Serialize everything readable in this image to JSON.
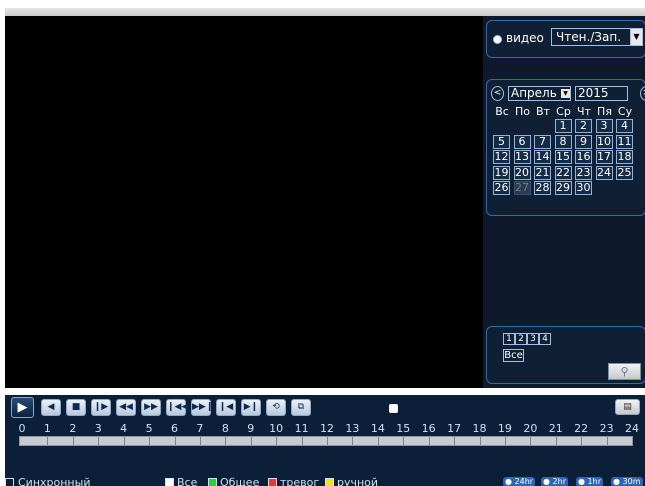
{
  "right_panel": {
    "mode": {
      "label": "видео",
      "selected": "Чтен./Зап."
    },
    "calendar": {
      "month": "Апрель",
      "year": "2015",
      "prev": "<",
      "next": ">",
      "weekdays": [
        "Вс",
        "По",
        "Вт",
        "Ср",
        "Чт",
        "Пя",
        "Су"
      ],
      "days": [
        "1",
        "2",
        "3",
        "4",
        "5",
        "6",
        "7",
        "8",
        "9",
        "10",
        "11",
        "12",
        "13",
        "14",
        "15",
        "16",
        "17",
        "18",
        "19",
        "20",
        "21",
        "22",
        "23",
        "24",
        "25",
        "26",
        "27",
        "28",
        "29",
        "30"
      ],
      "selected_day": "27"
    },
    "channels": [
      "1",
      "2",
      "3",
      "4"
    ],
    "channels_all": "Все"
  },
  "timeline": {
    "hours": [
      "0",
      "1",
      "2",
      "3",
      "4",
      "5",
      "6",
      "7",
      "8",
      "9",
      "10",
      "11",
      "12",
      "13",
      "14",
      "15",
      "16",
      "17",
      "18",
      "19",
      "20",
      "21",
      "22",
      "23",
      "24"
    ]
  },
  "bottom": {
    "sync_label": "Синхронный",
    "filters": [
      {
        "label": "Все",
        "color": "#ffffff"
      },
      {
        "label": "Общее",
        "color": "#2ecc40"
      },
      {
        "label": "тревог",
        "color": "#e53935"
      },
      {
        "label": "ручной",
        "color": "#f2e40f"
      }
    ],
    "zoom": [
      "24hr",
      "2hr",
      "1hr",
      "30m"
    ]
  },
  "colors": {
    "accent": "#2f6bb0",
    "panel": "#0f2035",
    "timeline_bg": "#0b1f38"
  }
}
